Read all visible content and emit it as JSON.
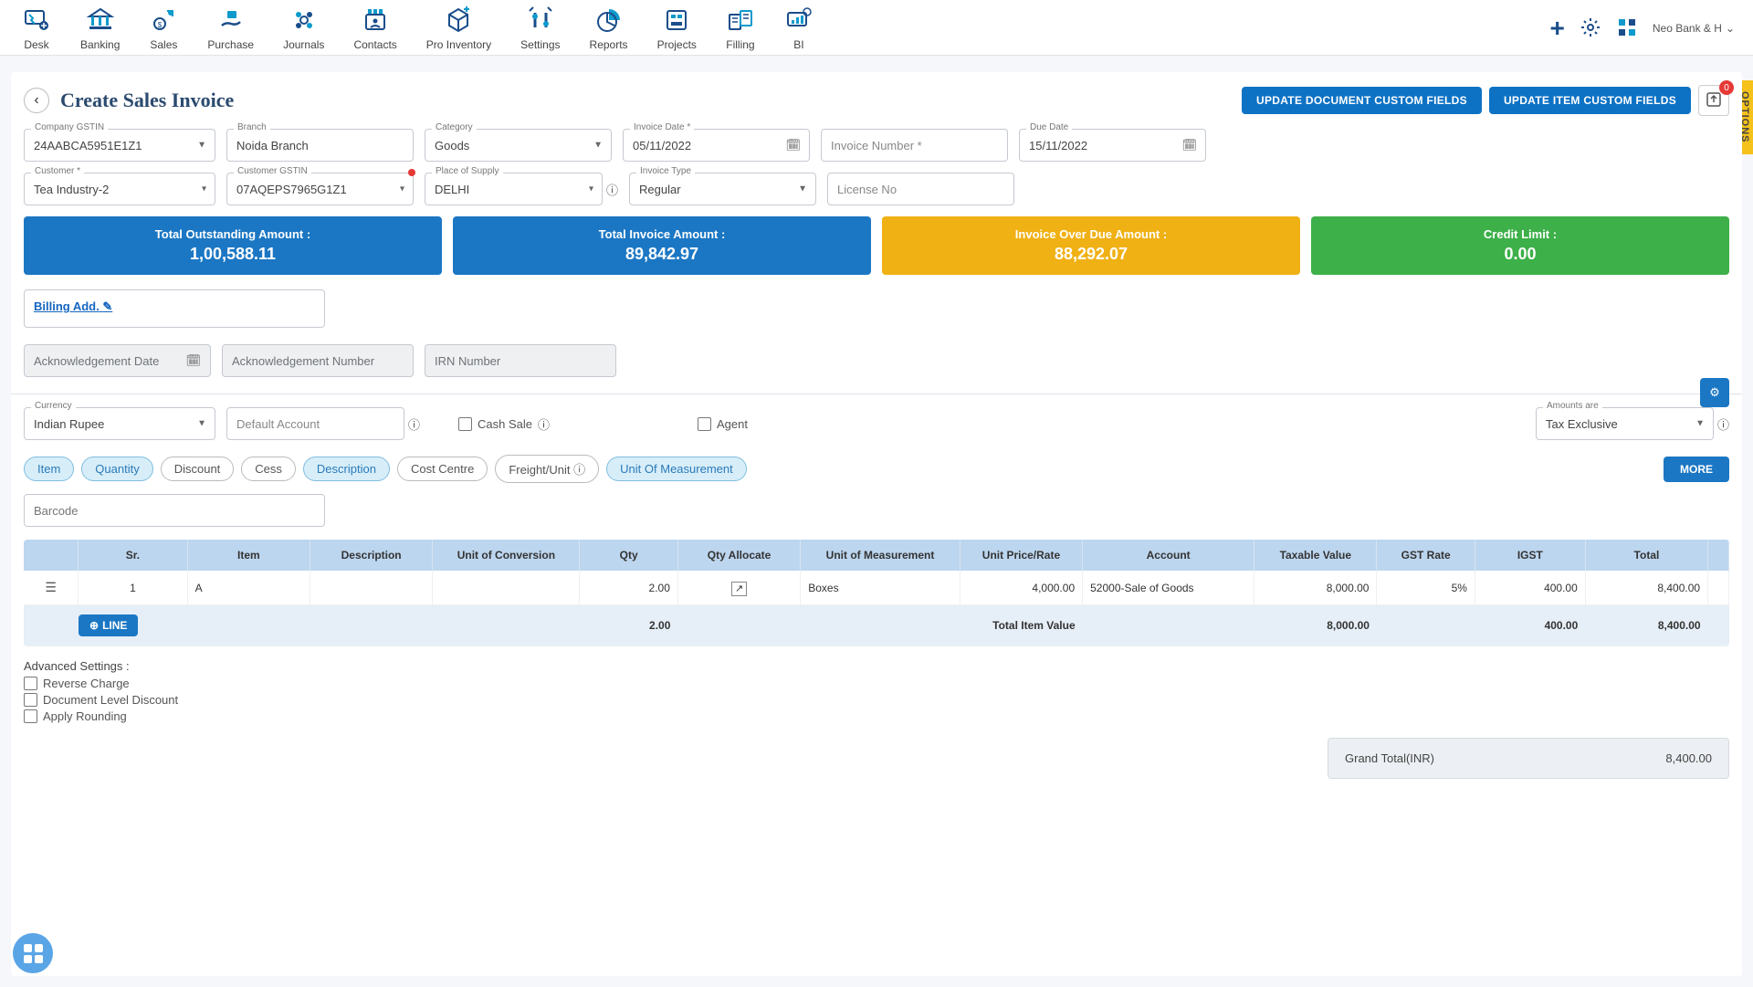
{
  "nav": {
    "items": [
      {
        "label": "Desk"
      },
      {
        "label": "Banking"
      },
      {
        "label": "Sales"
      },
      {
        "label": "Purchase"
      },
      {
        "label": "Journals"
      },
      {
        "label": "Contacts"
      },
      {
        "label": "Pro Inventory"
      },
      {
        "label": "Settings"
      },
      {
        "label": "Reports"
      },
      {
        "label": "Projects"
      },
      {
        "label": "Filling"
      },
      {
        "label": "BI"
      }
    ],
    "company": "Neo Bank & H"
  },
  "header": {
    "title": "Create Sales Invoice",
    "btn_doc_fields": "UPDATE DOCUMENT CUSTOM FIELDS",
    "btn_item_fields": "UPDATE ITEM CUSTOM FIELDS",
    "upload_badge": "0"
  },
  "form": {
    "company_gstin": {
      "label": "Company GSTIN",
      "value": "24AABCA5951E1Z1"
    },
    "branch": {
      "label": "Branch",
      "value": "Noida Branch"
    },
    "category": {
      "label": "Category",
      "value": "Goods"
    },
    "invoice_date": {
      "label": "Invoice Date *",
      "value": "05/11/2022"
    },
    "invoice_number": {
      "label": "",
      "placeholder": "Invoice Number *",
      "value": ""
    },
    "due_date": {
      "label": "Due Date",
      "value": "15/11/2022"
    },
    "customer": {
      "label": "Customer *",
      "value": "Tea Industry-2"
    },
    "customer_gstin": {
      "label": "Customer GSTIN",
      "value": "07AQEPS7965G1Z1"
    },
    "place_of_supply": {
      "label": "Place of Supply",
      "value": "DELHI"
    },
    "invoice_type": {
      "label": "Invoice Type",
      "value": "Regular"
    },
    "license_no": {
      "label": "",
      "placeholder": "License No",
      "value": ""
    }
  },
  "cards": {
    "outstanding": {
      "label": "Total Outstanding Amount :",
      "value": "1,00,588.11"
    },
    "invoice_total": {
      "label": "Total Invoice Amount :",
      "value": "89,842.97"
    },
    "overdue": {
      "label": "Invoice Over Due Amount :",
      "value": "88,292.07"
    },
    "credit_limit": {
      "label": "Credit Limit :",
      "value": "0.00"
    }
  },
  "billing_link": "Billing Add.",
  "ack": {
    "date_placeholder": "Acknowledgement Date",
    "number_placeholder": "Acknowledgement Number",
    "irn_placeholder": "IRN Number"
  },
  "currency_row": {
    "currency": {
      "label": "Currency",
      "value": "Indian Rupee"
    },
    "account": {
      "label": "",
      "placeholder": "Default Account"
    },
    "cash_sale": "Cash Sale",
    "agent": "Agent",
    "amounts_are": {
      "label": "Amounts are",
      "value": "Tax Exclusive"
    }
  },
  "chips": [
    "Item",
    "Quantity",
    "Discount",
    "Cess",
    "Description",
    "Cost Centre",
    "Freight/Unit",
    "Unit Of Measurement"
  ],
  "chips_active": [
    0,
    1,
    4,
    7
  ],
  "more_btn": "MORE",
  "barcode_placeholder": "Barcode",
  "table": {
    "headers": [
      "",
      "Sr.",
      "Item",
      "Description",
      "Unit of Conversion",
      "Qty",
      "Qty Allocate",
      "Unit of Measurement",
      "Unit Price/Rate",
      "Account",
      "Taxable Value",
      "GST Rate",
      "IGST",
      "Total"
    ],
    "row": {
      "sr": "1",
      "item": "A",
      "description": "",
      "uoc": "",
      "qty": "2.00",
      "uom": "Boxes",
      "rate": "4,000.00",
      "account": "52000-Sale of Goods",
      "taxable": "8,000.00",
      "gst_rate": "5%",
      "igst": "400.00",
      "total": "8,400.00"
    },
    "footer": {
      "add_line": "LINE",
      "qty_total": "2.00",
      "label": "Total Item Value",
      "taxable": "8,000.00",
      "igst": "400.00",
      "total": "8,400.00"
    }
  },
  "advanced": {
    "title": "Advanced Settings :",
    "reverse": "Reverse Charge",
    "doc_discount": "Document Level Discount",
    "rounding": "Apply Rounding"
  },
  "grand_total": {
    "label": "Grand Total(INR)",
    "value": "8,400.00"
  },
  "options_tab": "OPTIONS"
}
